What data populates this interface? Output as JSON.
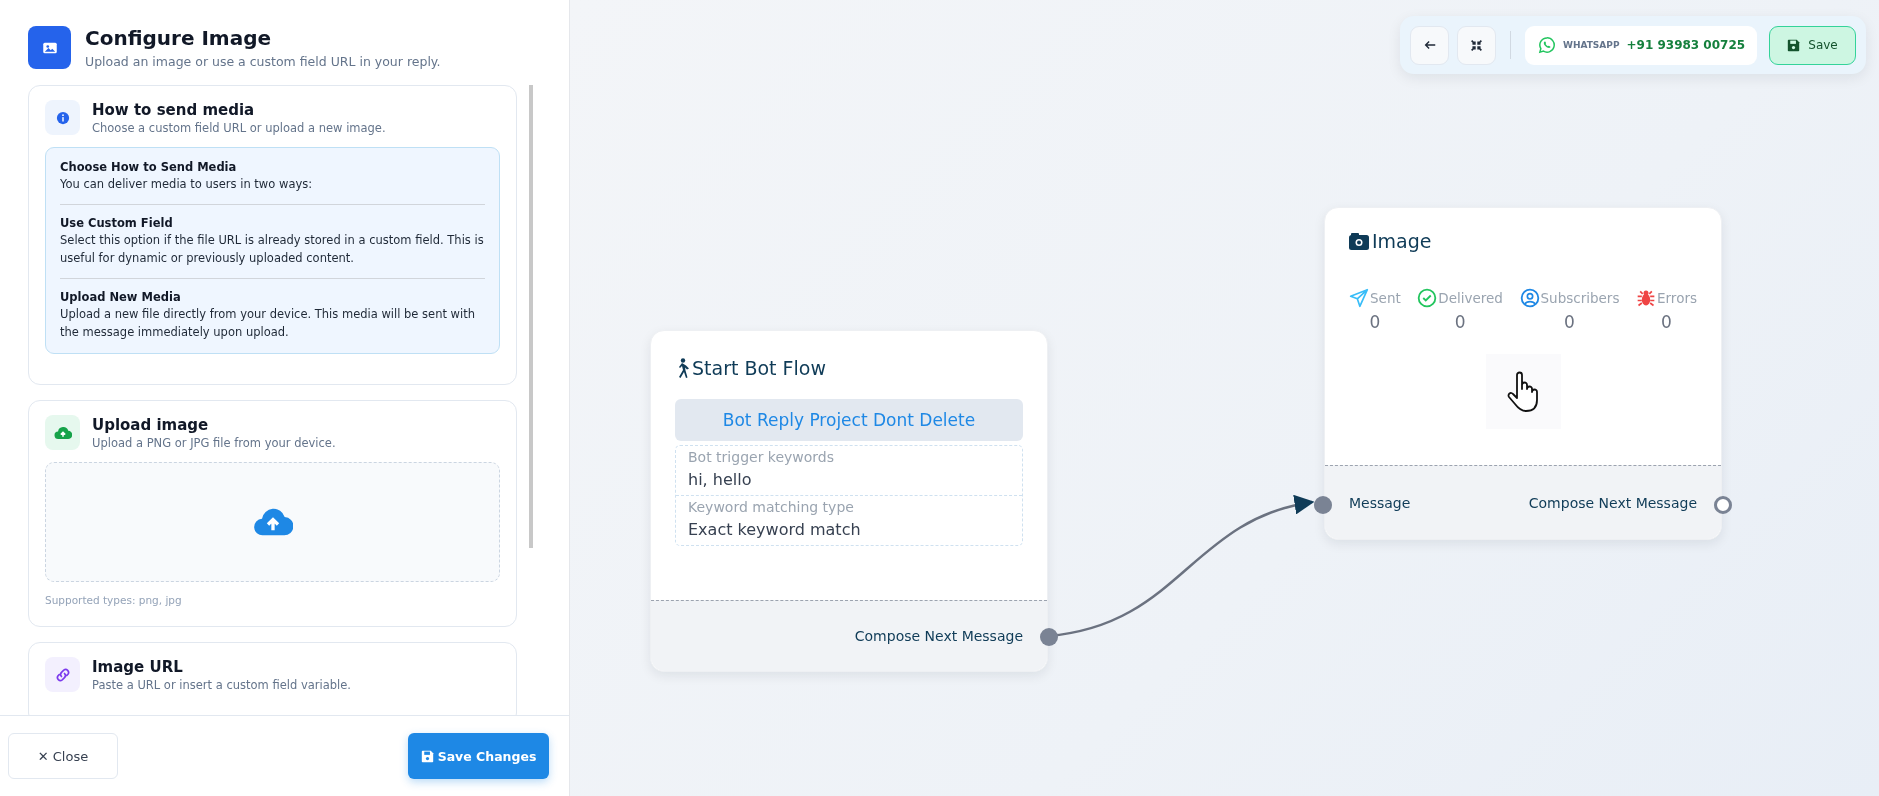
{
  "panel": {
    "title": "Configure Image",
    "subtitle": "Upload an image or use a custom field URL in your reply.",
    "sections": [
      {
        "kind": "info",
        "title": "How to send media",
        "subtitle": "Choose a custom field URL or upload a new image.",
        "blocks": [
          {
            "heading": "Choose How to Send Media",
            "text": "You can deliver media to users in two ways:"
          },
          {
            "heading": "Use Custom Field",
            "text": "Select this option if the file URL is already stored in a custom field. This is useful for dynamic or previously uploaded content."
          },
          {
            "heading": "Upload New Media",
            "text": "Upload a new file directly from your device. This media will be sent with the message immediately upon upload."
          }
        ]
      },
      {
        "kind": "upload",
        "title": "Upload image",
        "subtitle": "Upload a PNG or JPG file from your device.",
        "note": "Supported types: png, jpg"
      },
      {
        "kind": "url",
        "title": "Image URL",
        "subtitle": "Paste a URL or insert a custom field variable."
      }
    ],
    "close_button": "✕ Close",
    "save_button": "Save Changes"
  },
  "toolbar": {
    "channel": "WHATSAPP",
    "phone": "+91 93983 00725",
    "save_button": "Save"
  },
  "nodes": [
    {
      "kind": "start",
      "title": "Start Bot Flow",
      "flow_name": "Bot Reply Project Dont Delete",
      "fields": [
        {
          "label": "Bot trigger keywords",
          "value": "hi, hello"
        },
        {
          "label": "Keyword matching type",
          "value": "Exact keyword match"
        }
      ],
      "output": "Compose Next Message"
    },
    {
      "kind": "image",
      "title": "Image",
      "stats": [
        {
          "kind": "sent",
          "label": "Sent",
          "value": "0"
        },
        {
          "kind": "delivered",
          "label": "Delivered",
          "value": "0"
        },
        {
          "kind": "subscribers",
          "label": "Subscribers",
          "value": "0"
        },
        {
          "kind": "errors",
          "label": "Errors",
          "value": "0"
        }
      ],
      "input": "Message",
      "output": "Compose Next Message"
    }
  ]
}
